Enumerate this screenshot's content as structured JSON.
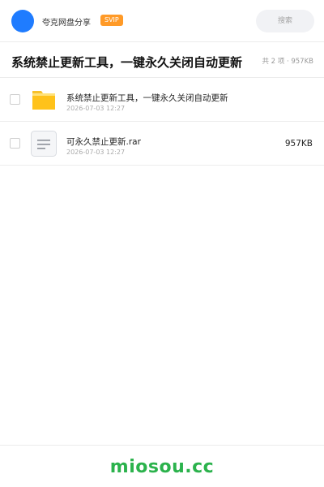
{
  "header": {
    "app_title": "夸克网盘分享",
    "badge": "SVIP",
    "search_placeholder": "搜索",
    "avatar_color": "#1f7cff",
    "badge_color": "#ff9a27"
  },
  "folder": {
    "title": "系统禁止更新工具，一键永久关闭自动更新",
    "summary": "共 2 项 · 957KB"
  },
  "files": [
    {
      "icon": "folder-icon",
      "name": "系统禁止更新工具，一键永久关闭自动更新",
      "date": "2026-07-03 12:27",
      "size": ""
    },
    {
      "icon": "archive-file-icon",
      "name": "可永久禁止更新.rar",
      "date": "2026-07-03 12:27",
      "size": "957KB"
    }
  ],
  "footer": {
    "watermark": "miosou.cc",
    "watermark_color": "#2bb24c"
  }
}
